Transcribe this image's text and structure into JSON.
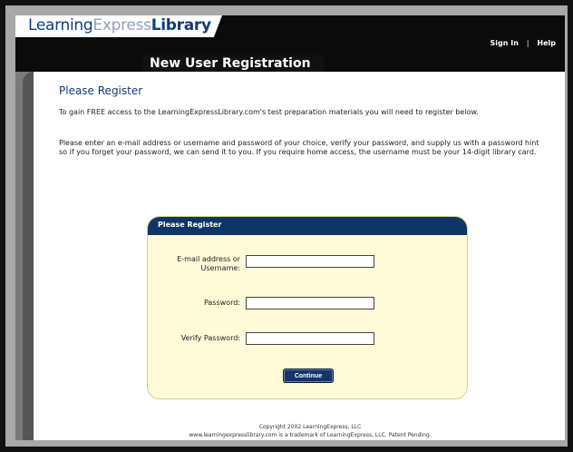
{
  "header": {
    "logo": {
      "part1": "Learning",
      "part2": "Express",
      "part3": "Library"
    },
    "nav": {
      "sign_in": "Sign In",
      "separator": "|",
      "help": "Help"
    },
    "page_title": "New User Registration"
  },
  "main": {
    "heading": "Please Register",
    "intro": "To gain FREE access to the LearningExpressLibrary.com's test preparation materials you will need to register below.",
    "instructions": "Please enter an e-mail address or username and password of your choice, verify your password, and supply us with a password hint so if you forget your password, we can send it to you. If you require home access, the username must be your 14-digit library card."
  },
  "form": {
    "title": "Please Register",
    "email_label": "E-mail address or Username:",
    "email_value": "",
    "password_label": "Password:",
    "password_value": "",
    "verify_label": "Verify Password:",
    "verify_value": "",
    "continue_label": "Continue"
  },
  "footer": {
    "copyright": "Copyright 2002 LearningExpress, LLC",
    "trademark": "www.learningexpresslibrary.com is a trademark of LearningExpress, LLC. Patent Pending."
  },
  "colors": {
    "brand_blue": "#0f3568",
    "form_background": "#fffbd8",
    "header_black": "#0b0b0b"
  }
}
